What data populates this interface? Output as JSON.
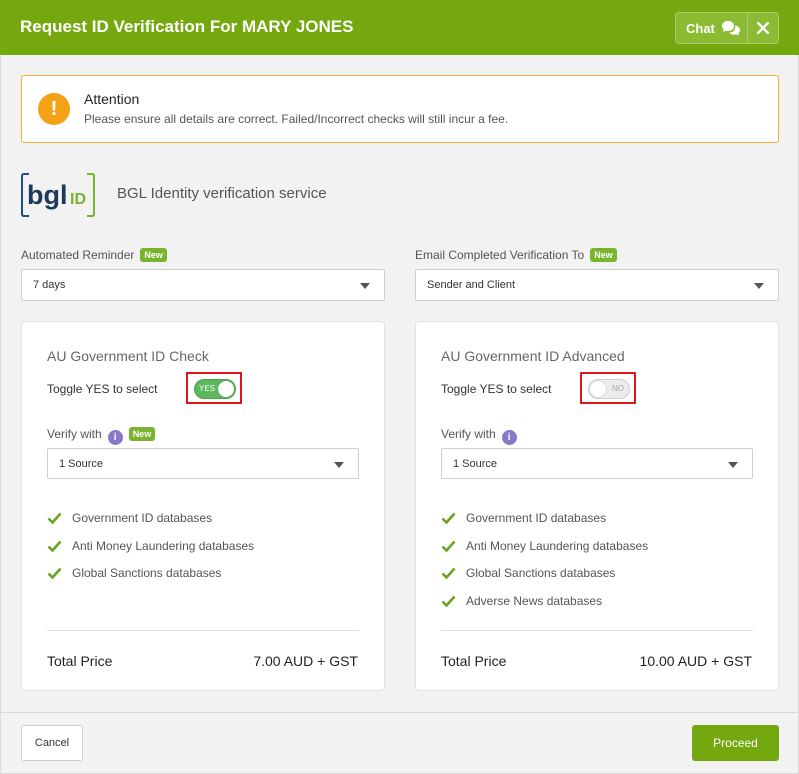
{
  "header": {
    "title": "Request ID Verification For MARY JONES",
    "chat_label": "Chat"
  },
  "alert": {
    "icon": "exclamation-icon",
    "title": "Attention",
    "text": "Please ensure all details are correct. Failed/Incorrect checks will still incur a fee."
  },
  "service": {
    "logo_text": "bgl",
    "logo_badge": "ID",
    "name": "BGL Identity verification service"
  },
  "reminder": {
    "label": "Automated Reminder",
    "badge": "New",
    "value": "7 days"
  },
  "email": {
    "label": "Email Completed Verification To",
    "badge": "New",
    "value": "Sender and Client"
  },
  "cards": [
    {
      "title": "AU Government ID Check",
      "toggle_label": "Toggle YES to select",
      "toggle_state": "YES",
      "verify_label": "Verify with",
      "verify_badge": "New",
      "source": "1 Source",
      "features": [
        "Government ID databases",
        "Anti Money Laundering databases",
        "Global Sanctions databases"
      ],
      "price_label": "Total Price",
      "price": "7.00 AUD + GST"
    },
    {
      "title": "AU Government ID Advanced",
      "toggle_label": "Toggle YES to select",
      "toggle_state": "NO",
      "verify_label": "Verify with",
      "source": "1 Source",
      "features": [
        "Government ID databases",
        "Anti Money Laundering databases",
        "Global Sanctions databases",
        "Adverse News databases"
      ],
      "price_label": "Total Price",
      "price": "10.00 AUD + GST"
    }
  ],
  "footer": {
    "cancel_label": "Cancel",
    "proceed_label": "Proceed"
  },
  "colors": {
    "brand_green": "#74a80e",
    "alert_orange": "#f5a316",
    "toggle_on": "#5cb85c",
    "highlight_red": "#e0141b",
    "info_purple": "#8a78c6"
  }
}
